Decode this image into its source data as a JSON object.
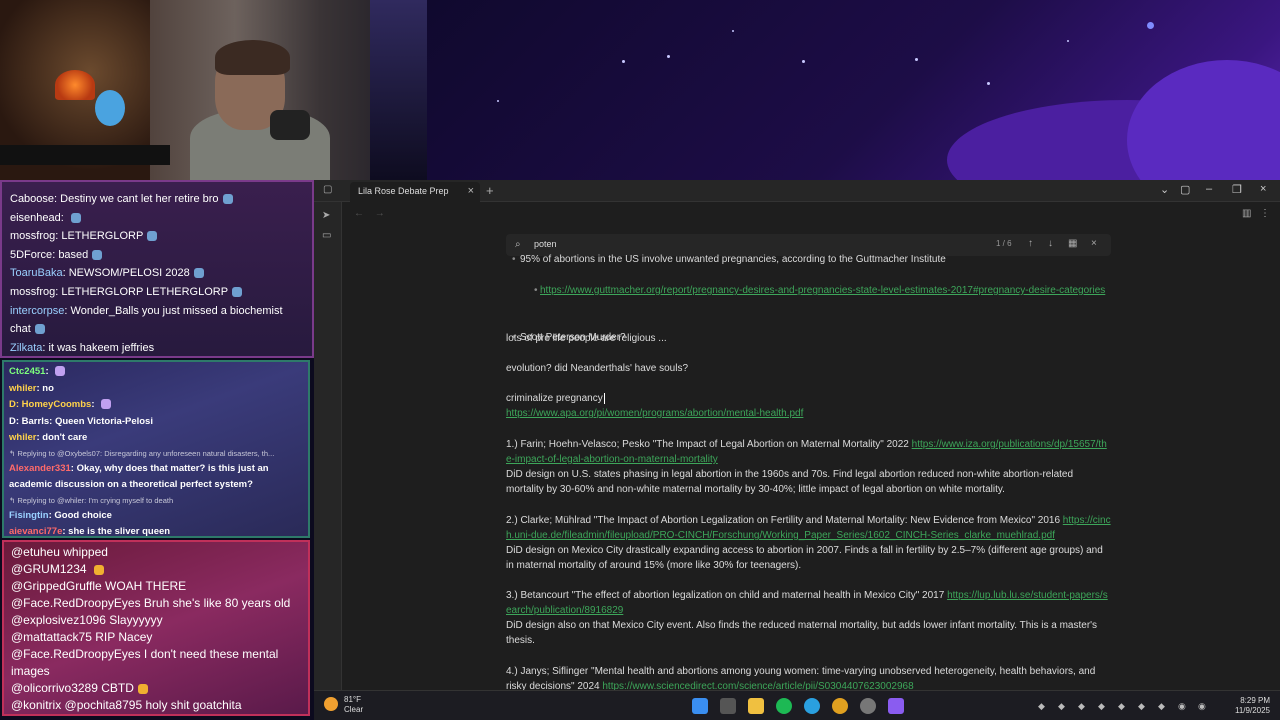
{
  "chat1": [
    {
      "user": "Caboose",
      "color": "#ffffff",
      "text": "Destiny we cant let her retire bro",
      "emote": true
    },
    {
      "user": "eisenhead",
      "color": "#ffffff",
      "text": "",
      "emote": true
    },
    {
      "user": "mossfrog",
      "color": "#ffffff",
      "text": "LETHERGLORP",
      "emote": true
    },
    {
      "user": "5DForce",
      "color": "#ffffff",
      "text": "based",
      "emote": true
    },
    {
      "user": "ToaruBaka",
      "color": "#9ad0ff",
      "text": "NEWSOM/PELOSI 2028",
      "emote": true
    },
    {
      "user": "mossfrog",
      "color": "#ffffff",
      "text": "LETHERGLORP LETHERGLORP",
      "emote": true
    },
    {
      "user": "intercorpse",
      "color": "#9ad0ff",
      "text": "Wonder_Balls you just missed a biochemist",
      "emote": false
    },
    {
      "user": "",
      "color": "#ffffff",
      "text": "chat",
      "emote": true
    },
    {
      "user": "Zilkata",
      "color": "#9ad0ff",
      "text": "it was hakeem jeffries",
      "emote": false
    }
  ],
  "chat2": [
    {
      "type": "msg",
      "user": "Ctc2451",
      "color": "#7dff7d",
      "text": ""
    },
    {
      "type": "msg",
      "user": "whiler",
      "color": "#ffd24a",
      "text": "no"
    },
    {
      "type": "msg",
      "user": "D: HomeyCoombs",
      "color": "#ffd24a",
      "text": ""
    },
    {
      "type": "msg",
      "user": "D: Barrls",
      "color": "#ffffff",
      "text": "Queen Victoria-Pelosi"
    },
    {
      "type": "msg",
      "user": "whiler",
      "color": "#ffd24a",
      "text": "don't care"
    },
    {
      "type": "reply",
      "text": "Replying to @Oxybels07: Disregarding any unforeseen natural disasters, th..."
    },
    {
      "type": "msg",
      "user": "Alexander331",
      "color": "#ff6a6a",
      "text": "Okay, why does that matter? is this just an"
    },
    {
      "type": "cont",
      "text": "academic discussion on a theoretical perfect system?"
    },
    {
      "type": "reply",
      "text": "Replying to @whiler: I'm crying myself to death"
    },
    {
      "type": "msg",
      "user": "Fisingtin",
      "color": "#9ad0ff",
      "text": "Good choice"
    },
    {
      "type": "msg",
      "user": "aievanci77e",
      "color": "#ff6a6a",
      "text": "she is the sliver queen"
    }
  ],
  "chat3": [
    {
      "user": "@etuheu",
      "text": "whipped"
    },
    {
      "user": "@GRUM1234",
      "text": ""
    },
    {
      "user": "@GrippedGruffle",
      "text": "WOAH THERE"
    },
    {
      "user": "@Face.RedDroopyEyes",
      "text": "Bruh she's like 80 years old"
    },
    {
      "user": "@explosivez1096",
      "text": "Slayyyyyy"
    },
    {
      "user": "@mattattack75",
      "text": "RIP Nacey"
    },
    {
      "user": "@Face.RedDroopyEyes",
      "text": "I don't need these mental images"
    },
    {
      "user": "@olicorrivo3289",
      "text": "CBTD"
    },
    {
      "user": "@konitrix",
      "text": "@pochita8795 holy shit goatchita"
    }
  ],
  "obsidian": {
    "tab_title": "Lila Rose Debate Prep",
    "search_query": "poten",
    "search_count": "1 / 6",
    "doc": {
      "b1": "95% of abortions in the US involve unwanted pregnancies, according to the Guttmacher Institute",
      "b1_link": "https://www.guttmacher.org/report/pregnancy-desires-and-pregnancies-state-level-estimates-2017#pregnancy-desire-categories",
      "b2": "Scott Peterson Murder?",
      "p1": "lots of pro life people are religious ...",
      "p2": "evolution? did Neanderthals' have souls?",
      "p3": "criminalize pregnancy",
      "p3_link": "https://www.apa.org/pi/women/programs/abortion/mental-health.pdf",
      "s1": "1.) Farin; Hoehn-Velasco; Pesko \"The Impact of Legal Abortion on Maternal Mortality\" 2022",
      "s1_link": "https://www.iza.org/publications/dp/15657/the-impact-of-legal-abortion-on-maternal-mortality",
      "s1_desc": "DiD design on U.S. states phasing in legal abortion in the 1960s and 70s. Find legal abortion reduced non-white abortion-related mortality by 30-60% and non-white maternal mortality by 30-40%; little impact of legal abortion on white mortality.",
      "s2": "2.) Clarke; Mühlrad \"The Impact of Abortion Legalization on Fertility and Maternal Mortality: New Evidence from Mexico\" 2016",
      "s2_link": "https://cinch.uni-due.de/fileadmin/fileupload/PRO-CINCH/Forschung/Working_Paper_Series/1602_CINCH-Series_clarke_muehlrad.pdf",
      "s2_desc": "DiD design on Mexico City drastically expanding access to abortion in 2007. Finds a fall in fertility by 2.5–7% (different age groups) and in maternal mortality of around 15% (more like 30% for teenagers).",
      "s3": "3.) Betancourt \"The effect of abortion legalization on child and maternal health in Mexico City\" 2017",
      "s3_link": "https://lup.lub.lu.se/student-papers/search/publication/8916829",
      "s3_desc": "DiD design also on that Mexico City event. Also finds the reduced maternal mortality, but adds lower infant mortality. This is a master's thesis.",
      "s4": "4.) Janys; Siflinger \"Mental health and abortions among young women: time-varying unobserved heterogeneity, health behaviors, and risky decisions\" 2024",
      "s4_link": "https://www.sciencedirect.com/science/article/pii/S0304407623002968"
    }
  },
  "taskbar": {
    "temp": "81°F",
    "condition": "Clear",
    "time": "8:29 PM",
    "date": "11/9/2025"
  }
}
